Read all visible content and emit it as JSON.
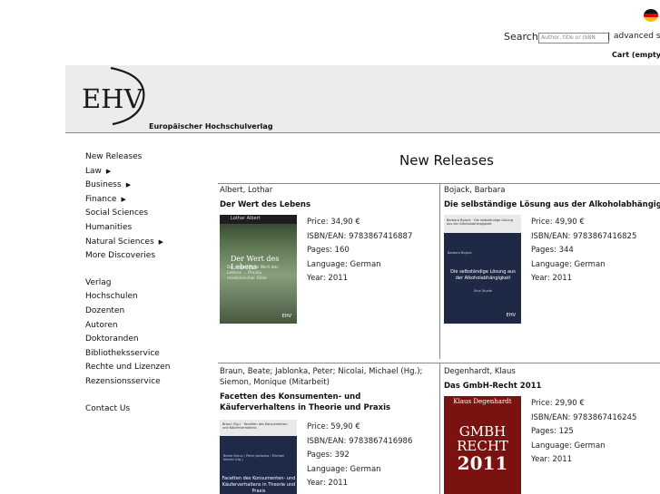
{
  "topbar": {
    "language_flag": "german-flag-icon",
    "search_label": "Search:",
    "search_placeholder": "Author, title or ISBN",
    "separator": "|",
    "advanced_search": "advanced sea",
    "cart": "Cart (empty)"
  },
  "header": {
    "logo": "EHV",
    "publisher_name": "Europäischer Hochschulverlag"
  },
  "sidebar": {
    "groups": [
      [
        {
          "label": "New Releases",
          "submenu": false
        },
        {
          "label": "Law",
          "submenu": true
        },
        {
          "label": "Business",
          "submenu": true
        },
        {
          "label": "Finance",
          "submenu": true
        },
        {
          "label": "Social Sciences",
          "submenu": false
        },
        {
          "label": "Humanities",
          "submenu": false
        },
        {
          "label": "Natural Sciences",
          "submenu": true
        },
        {
          "label": "More Discoveries",
          "submenu": false
        }
      ],
      [
        {
          "label": "Verlag",
          "submenu": false
        },
        {
          "label": "Hochschulen",
          "submenu": false
        },
        {
          "label": "Dozenten",
          "submenu": false
        },
        {
          "label": "Autoren",
          "submenu": false
        },
        {
          "label": "Doktoranden",
          "submenu": false
        },
        {
          "label": "Bibliotheksservice",
          "submenu": false
        },
        {
          "label": "Rechte und Lizenzen",
          "submenu": false
        },
        {
          "label": "Rezensionsservice",
          "submenu": false
        }
      ],
      [
        {
          "label": "Contact Us",
          "submenu": false
        }
      ]
    ]
  },
  "main": {
    "title": "New Releases",
    "books": [
      {
        "author": "Albert, Lothar",
        "title": "Der Wert des Lebens",
        "price": "Price: 34,90 €",
        "isbn": "ISBN/EAN: 9783867416887",
        "pages": "Pages: 160",
        "language": "Language: German",
        "year": "Year: 2011",
        "cover": {
          "top": "Lothar Albert",
          "title": "Der Wert des Lebens",
          "subtitle": "Der unbedingte Wert des Lebens ... Prinzip medizinischer Ethik",
          "publisher": "EHV"
        }
      },
      {
        "author": "Bojack, Barbara",
        "title": "Die selbständige Lösung aus der Alkoholabhängigkeit",
        "price": "Price: 49,90 €",
        "isbn": "ISBN/EAN: 9783867416825",
        "pages": "Pages: 344",
        "language": "Language: German",
        "year": "Year: 2011",
        "cover": {
          "top": "Barbara Bojack · Die selbständige Lösung aus der Alkoholabhängigkeit",
          "author": "Barbara Bojack",
          "title": "Die selbständige Lösung aus der Alkoholabhängigkeit",
          "subtitle": "Eine Studie",
          "publisher": "EHV"
        }
      },
      {
        "author": "Braun, Beate; Jablonka, Peter; Nicolai, Michael (Hg.); Siemon, Monique (Mitarbeit)",
        "title": "Facetten des Konsumenten- und Käuferverhaltens in Theorie und Praxis",
        "price": "Price: 59,90 €",
        "isbn": "ISBN/EAN: 9783867416986",
        "pages": "Pages: 392",
        "language": "Language: German",
        "year": "Year: 2011",
        "cover": {
          "top": "Braun (Hg.) · Facetten des Konsumenten- und Käuferverhaltens",
          "editors": "Beate Braun / Peter Jablonka / Michael Nicolai (Hg.)",
          "title": "Facetten des Konsumenten- und Käuferverhaltens in Theorie und Praxis"
        }
      },
      {
        "author": "Degenhardt, Klaus",
        "title": "Das GmbH-Recht 2011",
        "price": "Price: 29,90 €",
        "isbn": "ISBN/EAN: 9783867416245",
        "pages": "Pages: 125",
        "language": "Language: German",
        "year": "Year: 2011",
        "cover": {
          "author": "Klaus Degenhardt",
          "line1": "GMBH",
          "line2": "RECHT",
          "line3": "2011"
        }
      }
    ]
  }
}
